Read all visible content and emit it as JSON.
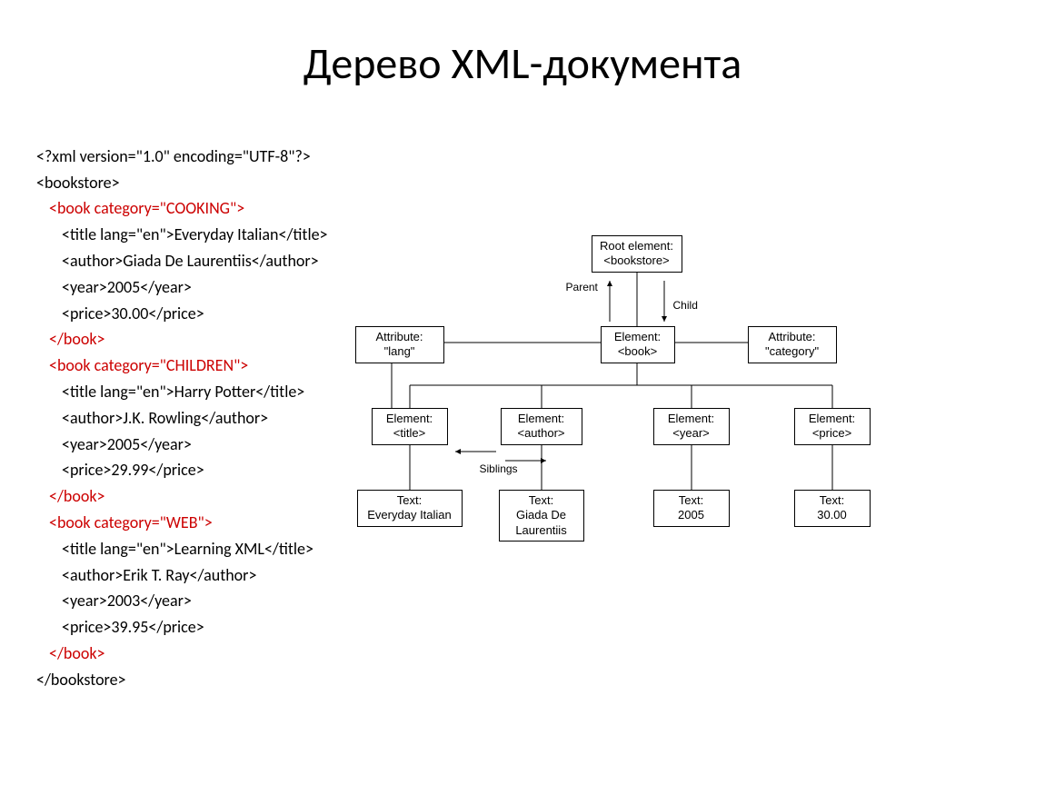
{
  "title": "Дерево XML-документа",
  "xml": {
    "decl": "<?xml version=\"1.0\" encoding=\"UTF-8\"?>",
    "root_open": "<bookstore>",
    "root_close": "</bookstore>",
    "books": [
      {
        "open": "<book category=\"COOKING\">",
        "title": "<title lang=\"en\">Everyday Italian</title>",
        "author": "<author>Giada De Laurentiis</author>",
        "year": "<year>2005</year>",
        "price": "<price>30.00</price>",
        "close": "</book>"
      },
      {
        "open": "<book category=\"CHILDREN\">",
        "title": "<title lang=\"en\">Harry Potter</title>",
        "author": "<author>J.K. Rowling</author>",
        "year": "<year>2005</year>",
        "price": "<price>29.99</price>",
        "close": "</book>"
      },
      {
        "open": "<book category=\"WEB\">",
        "title": "<title lang=\"en\">Learning XML</title>",
        "author": "<author>Erik T. Ray</author>",
        "year": "<year>2003</year>",
        "price": "<price>39.95</price>",
        "close": "</book>"
      }
    ]
  },
  "diagram": {
    "root": {
      "l1": "Root element:",
      "l2": "<bookstore>"
    },
    "parent_label": "Parent",
    "child_label": "Child",
    "attr_lang": {
      "l1": "Attribute:",
      "l2": "\"lang\""
    },
    "elem_book": {
      "l1": "Element:",
      "l2": "<book>"
    },
    "attr_cat": {
      "l1": "Attribute:",
      "l2": "\"category\""
    },
    "elem_title": {
      "l1": "Element:",
      "l2": "<title>"
    },
    "elem_author": {
      "l1": "Element:",
      "l2": "<author>"
    },
    "elem_year": {
      "l1": "Element:",
      "l2": "<year>"
    },
    "elem_price": {
      "l1": "Element:",
      "l2": "<price>"
    },
    "siblings_label": "Siblings",
    "text_title": {
      "l1": "Text:",
      "l2": "Everyday Italian"
    },
    "text_author": {
      "l1": "Text:",
      "l2": "Giada De",
      "l3": "Laurentiis"
    },
    "text_year": {
      "l1": "Text:",
      "l2": "2005"
    },
    "text_price": {
      "l1": "Text:",
      "l2": "30.00"
    }
  }
}
